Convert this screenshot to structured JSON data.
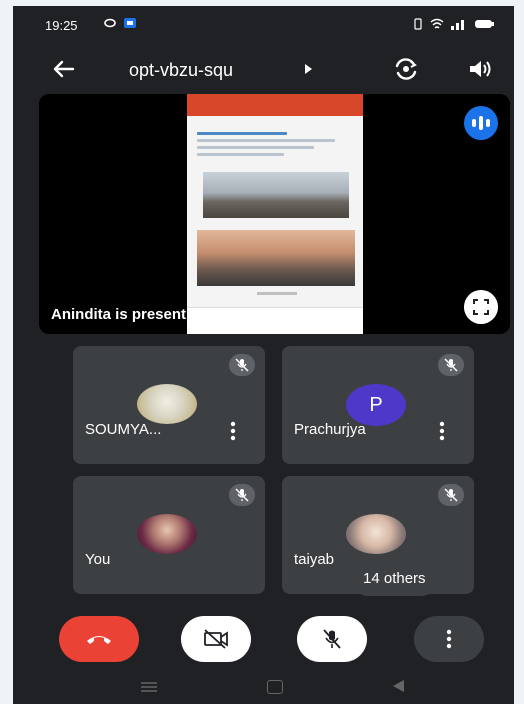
{
  "status_bar": {
    "time": "19:25",
    "right_indicators": "‡ ≡ ≈ ▭"
  },
  "app_bar": {
    "meeting_code": "opt-vbzu-squ"
  },
  "presentation": {
    "label": "Anindita is presenting"
  },
  "participants": [
    {
      "name": "SOUMYA...",
      "type": "photo"
    },
    {
      "name": "Prachurjya",
      "type": "letter",
      "initial": "P",
      "color": "#4e38c9"
    },
    {
      "name": "You",
      "type": "photo"
    },
    {
      "name": "taiyab",
      "type": "photo"
    }
  ],
  "others_badge": "14 others",
  "colors": {
    "end_call": "#ea4335",
    "background": "#202124",
    "tile": "#3c4043",
    "accent": "#1a73e8"
  },
  "icons": [
    "back-arrow-icon",
    "switch-camera-icon",
    "speaker-icon",
    "audio-level-icon",
    "fullscreen-icon",
    "mic-off-icon",
    "more-vert-icon",
    "end-call-icon",
    "video-off-icon"
  ]
}
